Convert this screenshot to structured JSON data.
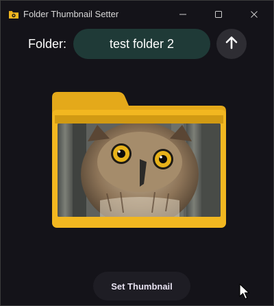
{
  "window": {
    "title": "Folder Thumbnail Setter",
    "app_icon": "camera-folder-icon",
    "controls": {
      "minimize_icon": "minimize-icon",
      "maximize_icon": "maximize-icon",
      "close_icon": "close-icon"
    }
  },
  "folder": {
    "label": "Folder:",
    "value": "test folder 2",
    "up_icon": "arrow-up-icon"
  },
  "preview": {
    "folder_icon": "folder-icon",
    "thumbnail_subject": "owl photo thumbnail",
    "folder_color": "#f2b720",
    "folder_back_color": "#e4a91a"
  },
  "actions": {
    "set_thumbnail_label": "Set Thumbnail"
  },
  "colors": {
    "background": "#141319",
    "field_bg": "#1f3a37",
    "button_bg": "#1e1d24",
    "text": "#ffffff"
  }
}
